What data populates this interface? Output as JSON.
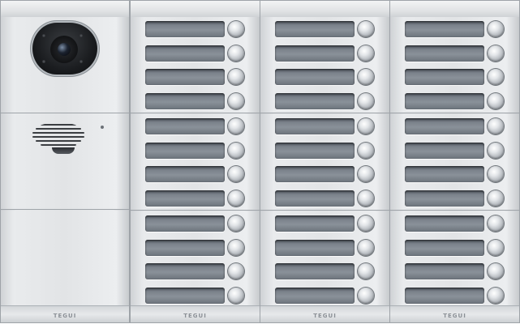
{
  "brand": {
    "logo_text": "TEGUI"
  },
  "panel": {
    "description": "Video entry intercom panel",
    "left_column": {
      "modules": [
        "camera",
        "speaker",
        "blank"
      ],
      "camera_icon": "camera-icon",
      "speaker_icon": "speaker-grille-icon"
    },
    "button_columns": 3,
    "modules_per_column": 3,
    "buttons_per_module": 4,
    "colors": {
      "aluminium": "#e2e4e6",
      "name_plate": "#7b828b",
      "lens": "#1b1d20"
    }
  }
}
